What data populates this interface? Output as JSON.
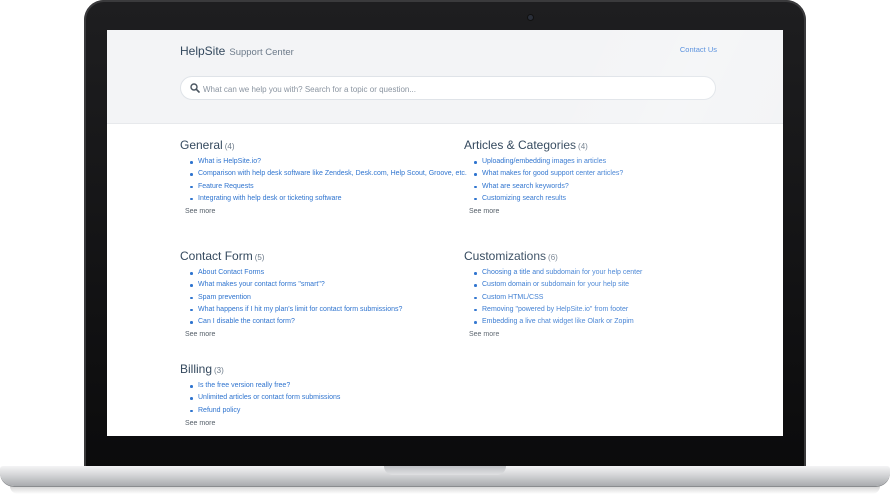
{
  "header": {
    "brand_name": "HelpSite",
    "brand_subtitle": "Support Center",
    "contact_link": "Contact Us"
  },
  "search": {
    "placeholder": "What can we help you with? Search for a topic or question..."
  },
  "see_more_label": "See more",
  "categories": [
    {
      "title": "General",
      "count": "(4)",
      "articles": [
        "What is HelpSite.io?",
        "Comparison with help desk software like Zendesk, Desk.com, Help Scout, Groove, etc.",
        "Feature Requests",
        "Integrating with help desk or ticketing software"
      ]
    },
    {
      "title": "Articles & Categories",
      "count": "(4)",
      "articles": [
        "Uploading/embedding images in articles",
        "What makes for good support center articles?",
        "What are search keywords?",
        "Customizing search results"
      ]
    },
    {
      "title": "Contact Form",
      "count": "(5)",
      "articles": [
        "About Contact Forms",
        "What makes your contact forms \"smart\"?",
        "Spam prevention",
        "What happens if I hit my plan's limit for contact form submissions?",
        "Can I disable the contact form?"
      ]
    },
    {
      "title": "Customizations",
      "count": "(6)",
      "articles": [
        "Choosing a title and subdomain for your help center",
        "Custom domain or subdomain for your help site",
        "Custom HTML/CSS",
        "Removing \"powered by HelpSite.io\" from footer",
        "Embedding a live chat widget like Olark or Zopim"
      ]
    },
    {
      "title": "Billing",
      "count": "(3)",
      "articles": [
        "Is the free version really free?",
        "Unlimited articles or contact form submissions",
        "Refund policy"
      ]
    }
  ]
}
